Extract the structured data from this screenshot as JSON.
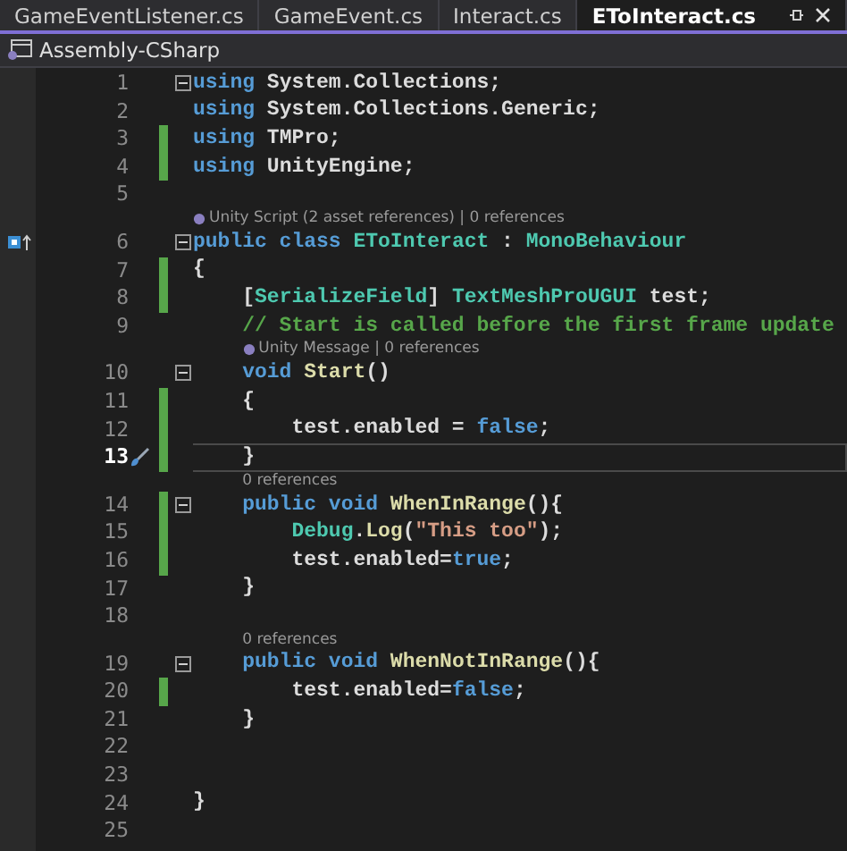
{
  "tabs": [
    {
      "label": "GameEventListener.cs",
      "selected": false
    },
    {
      "label": "GameEvent.cs",
      "selected": false
    },
    {
      "label": "Interact.cs",
      "selected": false
    },
    {
      "label": "EToInteract.cs",
      "selected": true
    }
  ],
  "project": {
    "label": "Assembly-CSharp"
  },
  "lines": [
    {
      "number": "1",
      "changed": false,
      "expanded": true,
      "tokens": [
        {
          "text": "using",
          "kind": "keyword"
        },
        {
          "text": " System.Collections;",
          "kind": "plain"
        }
      ]
    },
    {
      "number": "2",
      "changed": false,
      "tokens": [
        {
          "text": "using",
          "kind": "keyword"
        },
        {
          "text": " System.Collections.Generic;",
          "kind": "plain"
        }
      ]
    },
    {
      "number": "3",
      "changed": true,
      "tokens": [
        {
          "text": "using",
          "kind": "keyword"
        },
        {
          "text": " TMPro;",
          "kind": "plain"
        }
      ]
    },
    {
      "number": "4",
      "changed": true,
      "tokens": [
        {
          "text": "using",
          "kind": "keyword"
        },
        {
          "text": " UnityEngine;",
          "kind": "plain"
        }
      ]
    },
    {
      "number": "5",
      "changed": false
    },
    {
      "number": "6",
      "changed": false,
      "expanded": true,
      "marker": true,
      "lens": {
        "kind": "unity",
        "text": "Unity Script (2 asset references) | 0 references"
      },
      "tokens": [
        {
          "text": "public class",
          "kind": "keyword"
        },
        {
          "text": " EToInteract",
          "kind": "type"
        },
        {
          "text": " : ",
          "kind": "plain"
        },
        {
          "text": "MonoBehaviour",
          "kind": "type"
        }
      ]
    },
    {
      "number": "7",
      "changed": true,
      "tokens": [
        {
          "text": "{",
          "kind": "plain"
        }
      ]
    },
    {
      "number": "8",
      "changed": true,
      "tokens": [
        {
          "text": "    [",
          "kind": "plain"
        },
        {
          "text": "SerializeField",
          "kind": "type"
        },
        {
          "text": "] ",
          "kind": "plain"
        },
        {
          "text": "TextMeshProUGUI",
          "kind": "type"
        },
        {
          "text": " test;",
          "kind": "plain"
        }
      ]
    },
    {
      "number": "9",
      "changed": false,
      "tokens": [
        {
          "text": "    // Start is called before the first frame update",
          "kind": "comment"
        }
      ]
    },
    {
      "number": "10",
      "changed": false,
      "expanded": true,
      "lens": {
        "kind": "unity",
        "text": "Unity Message | 0 references"
      },
      "tokens": [
        {
          "text": "    void",
          "kind": "keyword"
        },
        {
          "text": " Start",
          "kind": "method"
        },
        {
          "text": "()",
          "kind": "plain"
        }
      ]
    },
    {
      "number": "11",
      "changed": true,
      "tokens": [
        {
          "text": "    {",
          "kind": "plain"
        }
      ]
    },
    {
      "number": "12",
      "changed": true,
      "tokens": [
        {
          "text": "        test.enabled = ",
          "kind": "plain"
        },
        {
          "text": "false",
          "kind": "keyword"
        },
        {
          "text": ";",
          "kind": "plain"
        }
      ]
    },
    {
      "number": "13",
      "changed": true,
      "current": true,
      "tokens": [
        {
          "text": "    }",
          "kind": "plain"
        }
      ]
    },
    {
      "number": "14",
      "changed": true,
      "expanded": true,
      "lens": {
        "kind": "plain",
        "text": "0 references"
      },
      "tokens": [
        {
          "text": "    public void",
          "kind": "keyword"
        },
        {
          "text": " WhenInRange",
          "kind": "method"
        },
        {
          "text": "(){",
          "kind": "plain"
        }
      ]
    },
    {
      "number": "15",
      "changed": true,
      "tokens": [
        {
          "text": "        Debug",
          "kind": "type"
        },
        {
          "text": ".",
          "kind": "plain"
        },
        {
          "text": "Log",
          "kind": "method"
        },
        {
          "text": "(",
          "kind": "plain"
        },
        {
          "text": "\"This too\"",
          "kind": "string"
        },
        {
          "text": ");",
          "kind": "plain"
        }
      ]
    },
    {
      "number": "16",
      "changed": true,
      "tokens": [
        {
          "text": "        test.enabled=",
          "kind": "plain"
        },
        {
          "text": "true",
          "kind": "keyword"
        },
        {
          "text": ";",
          "kind": "plain"
        }
      ]
    },
    {
      "number": "17",
      "changed": false,
      "tokens": [
        {
          "text": "    }",
          "kind": "plain"
        }
      ]
    },
    {
      "number": "18",
      "changed": false
    },
    {
      "number": "19",
      "changed": false,
      "expanded": true,
      "lens": {
        "kind": "plain",
        "text": "0 references"
      },
      "tokens": [
        {
          "text": "    public void",
          "kind": "keyword"
        },
        {
          "text": " WhenNotInRange",
          "kind": "method"
        },
        {
          "text": "(){",
          "kind": "plain"
        }
      ]
    },
    {
      "number": "20",
      "changed": true,
      "tokens": [
        {
          "text": "        test.enabled=",
          "kind": "plain"
        },
        {
          "text": "false",
          "kind": "keyword"
        },
        {
          "text": ";",
          "kind": "plain"
        }
      ]
    },
    {
      "number": "21",
      "changed": false,
      "tokens": [
        {
          "text": "    }",
          "kind": "plain"
        }
      ]
    },
    {
      "number": "22",
      "changed": false
    },
    {
      "number": "23",
      "changed": false
    },
    {
      "number": "24",
      "changed": false,
      "tokens": [
        {
          "text": "}",
          "kind": "plain"
        }
      ]
    },
    {
      "number": "25",
      "changed": false
    }
  ]
}
